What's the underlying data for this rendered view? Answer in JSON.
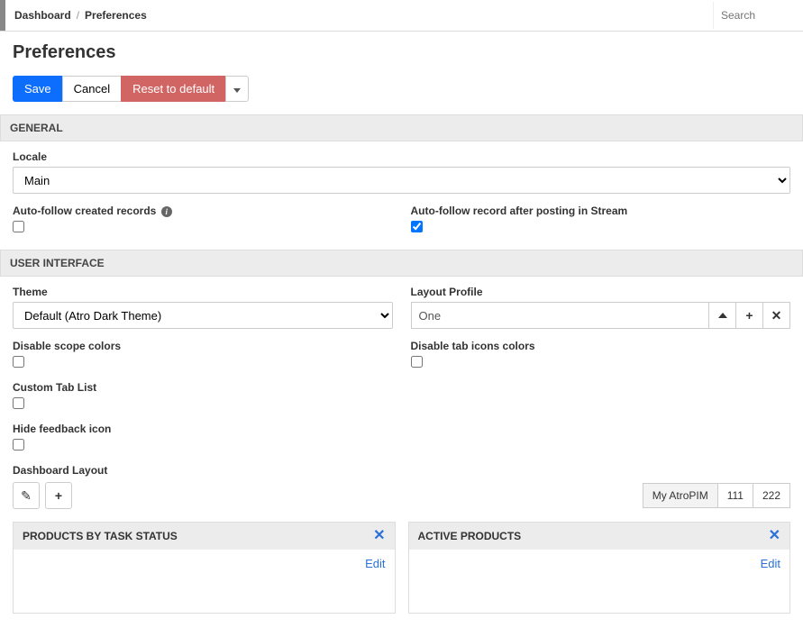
{
  "breadcrumb": {
    "root": "Dashboard",
    "sep": "/",
    "current": "Preferences"
  },
  "search": {
    "placeholder": "Search"
  },
  "title": "Preferences",
  "toolbar": {
    "save": "Save",
    "cancel": "Cancel",
    "reset": "Reset to default"
  },
  "sections": {
    "general": {
      "heading": "GENERAL",
      "locale_label": "Locale",
      "locale_value": "Main",
      "autofollow_created_label": "Auto-follow created records",
      "autofollow_stream_label": "Auto-follow record after posting in Stream"
    },
    "ui": {
      "heading": "USER INTERFACE",
      "theme_label": "Theme",
      "theme_value": "Default (Atro Dark Theme)",
      "layout_profile_label": "Layout Profile",
      "layout_profile_value": "One",
      "disable_scope_label": "Disable scope colors",
      "disable_tab_icons_label": "Disable tab icons colors",
      "custom_tab_label": "Custom Tab List",
      "hide_feedback_label": "Hide feedback icon",
      "dashboard_layout_label": "Dashboard Layout"
    }
  },
  "dashboard_tabs": [
    {
      "label": "My AtroPIM",
      "active": true
    },
    {
      "label": "111",
      "active": false
    },
    {
      "label": "222",
      "active": false
    }
  ],
  "dashlets": [
    {
      "title": "PRODUCTS BY TASK STATUS",
      "edit": "Edit"
    },
    {
      "title": "ACTIVE PRODUCTS",
      "edit": "Edit"
    }
  ],
  "icons": {
    "plus": "+",
    "pencil": "✎",
    "x": "✕",
    "info": "i"
  }
}
